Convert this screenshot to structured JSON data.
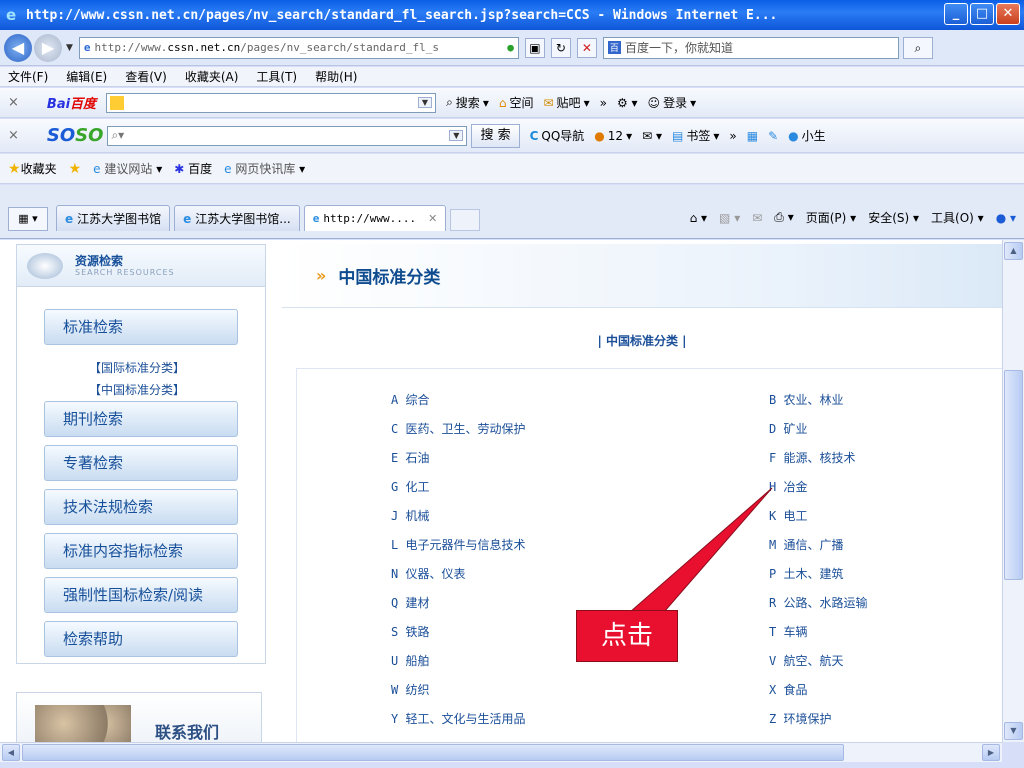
{
  "window": {
    "title": "http://www.cssn.net.cn/pages/nv_search/standard_fl_search.jsp?search=CCS - Windows Internet E...",
    "minimize": "_",
    "maximize": "□",
    "close": "✕"
  },
  "address": {
    "url_prefix": "http://www.",
    "url_domain": "cssn.net.cn",
    "url_path": "/pages/nv_search/standard_fl_s",
    "search_text": "百度一下，你就知道"
  },
  "menu": [
    "文件(F)",
    "编辑(E)",
    "查看(V)",
    "收藏夹(A)",
    "工具(T)",
    "帮助(H)"
  ],
  "toolbar1": {
    "close": "×",
    "brand_a": "Bai",
    "brand_b": "百度",
    "search": "搜索",
    "space": "空间",
    "tieba": "贴吧",
    "more": "»",
    "login": "登录"
  },
  "toolbar2": {
    "close": "×",
    "brand_a": "SO",
    "brand_b": "SO",
    "search_btn": "搜 索",
    "qq_nav": "QQ导航",
    "mail_count": "12",
    "bookmarks": "书签",
    "more": "»",
    "user": "小生"
  },
  "favorites": {
    "label": "收藏夹",
    "suggest": "建议网站",
    "baidu": "百度",
    "feeds": "网页快讯库"
  },
  "tabs": [
    {
      "label": "江苏大学图书馆"
    },
    {
      "label": "江苏大学图书馆..."
    },
    {
      "label": "http://www...."
    }
  ],
  "commandbar": {
    "page": "页面(P)",
    "safety": "安全(S)",
    "tools": "工具(O)"
  },
  "sidebar": {
    "title": "资源检索",
    "subtitle": "SEARCH RESOURCES",
    "items": [
      {
        "label": "标准检索"
      },
      {
        "label": "期刊检索"
      },
      {
        "label": "专著检索"
      },
      {
        "label": "技术法规检索"
      },
      {
        "label": "标准内容指标检索"
      },
      {
        "label": "强制性国标检索/阅读"
      },
      {
        "label": "检索帮助"
      }
    ],
    "sublinks": [
      "【国际标准分类】",
      "【中国标准分类】"
    ],
    "contact": "联系我们"
  },
  "main": {
    "heading": "中国标准分类",
    "subheading": "| 中国标准分类 |",
    "categories_left": [
      "A 综合",
      "C 医药、卫生、劳动保护",
      "E 石油",
      "G 化工",
      "J 机械",
      "L 电子元器件与信息技术",
      "N 仪器、仪表",
      "Q 建材",
      "S 铁路",
      "U 船舶",
      "W 纺织",
      "Y 轻工、文化与生活用品"
    ],
    "categories_right": [
      "B 农业、林业",
      "D 矿业",
      "F 能源、核技术",
      "H 冶金",
      "K 电工",
      "M 通信、广播",
      "P 土木、建筑",
      "R 公路、水路运输",
      "T 车辆",
      "V 航空、航天",
      "X 食品",
      "Z 环境保护"
    ]
  },
  "annotation": {
    "label": "点击",
    "color": "#e8102e"
  }
}
